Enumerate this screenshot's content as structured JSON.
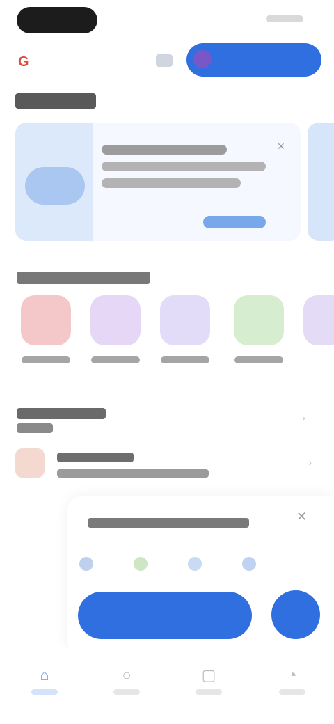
{
  "status_bar": {
    "time": ""
  },
  "header": {
    "logo_icon": "google-g-icon",
    "cta_label": "",
    "accent": "#2f6fe0"
  },
  "hero_card": {
    "title": "",
    "body": "",
    "action_label": ""
  },
  "categories": [
    {
      "label": "",
      "color": "#f4c8c8"
    },
    {
      "label": "",
      "color": "#e7d7f6"
    },
    {
      "label": "",
      "color": "#e2dcf8"
    },
    {
      "label": "",
      "color": "#d6edcf"
    },
    {
      "label": "",
      "color": "#e4dcf7"
    }
  ],
  "recent": {
    "title": "",
    "subtitle": "",
    "item_title": "",
    "item_detail": ""
  },
  "sheet": {
    "title": "",
    "button_label": ""
  },
  "bottom_nav": [
    {
      "label": "",
      "icon": "home-icon",
      "active": true
    },
    {
      "label": "",
      "icon": "search-icon",
      "active": false
    },
    {
      "label": "",
      "icon": "library-icon",
      "active": false
    },
    {
      "label": "",
      "icon": "profile-icon",
      "active": false
    }
  ]
}
